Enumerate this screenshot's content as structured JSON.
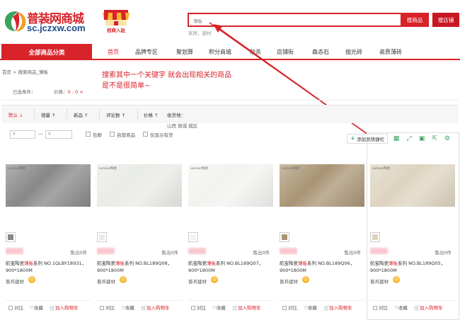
{
  "header": {
    "logo_text": "普装网商城",
    "logo_url": "sc.jczxw.com",
    "shop_badge": "招商入驻",
    "search_placeholder": "薄板",
    "search_button": "搜商品",
    "shop_search_button": "搜店铺",
    "hot_words": "家居，建材"
  },
  "nav": {
    "all_categories": "全部商品分类",
    "items": [
      "首页",
      "品牌专区",
      "聚划算",
      "积分商城",
      "秒杀",
      "店铺街",
      "森态石",
      "抛光砖",
      "瓷质薄砖"
    ]
  },
  "breadcrumb": "首页 > 搜索商品_薄板",
  "annotation": {
    "line1": "搜索其中一个关键字 就会出现相关的商品",
    "line2": "是不是很简单~"
  },
  "filter": {
    "label": "已选条件：",
    "tag_name": "价格：",
    "tag_value": "0 - 0",
    "tag_close": "×"
  },
  "sort": {
    "default": "默认",
    "sales": "销量",
    "new": "新品",
    "reviews": "评论数",
    "price": "价格",
    "location_label": "收货地：",
    "location_value": "山西 晋城 城区"
  },
  "price_filter": {
    "min_placeholder": "¥",
    "dash": "—",
    "max_placeholder": "¥",
    "free_shipping": "包邮",
    "self_operated": "自营商品",
    "in_stock": "仅显示有货"
  },
  "toolbar": {
    "add_quick": "添加到快捷栏",
    "add_icon": "+"
  },
  "products": [
    {
      "name_prefix": "航宝陶瓷",
      "name_kw": "薄板",
      "name_suffix": "系列 NO.1QLBY18931，900*1800M",
      "sold": "售出0件",
      "seller": "晋兵建材",
      "brand": "Lonsun陶瓷",
      "color": "#888888",
      "compare": "对比",
      "favorite": "收藏",
      "cart": "加入购物车"
    },
    {
      "name_prefix": "航宝陶瓷",
      "name_kw": "薄板",
      "name_suffix": "系列 NO.BL189Q08，900*1800M",
      "sold": "售出0件",
      "seller": "晋兵建材",
      "brand": "Lonsun陶瓷",
      "color": "#e9ebe6",
      "compare": "对比",
      "favorite": "收藏",
      "cart": "加入购物车"
    },
    {
      "name_prefix": "航宝陶瓷",
      "name_kw": "薄板",
      "name_suffix": "系列 NO.BL189Q07，900*1800M",
      "sold": "售出0件",
      "seller": "晋兵建材",
      "brand": "Lonsun陶瓷",
      "color": "#f2f2f0",
      "compare": "对比",
      "favorite": "收藏",
      "cart": "加入购物车"
    },
    {
      "name_prefix": "航宝陶瓷",
      "name_kw": "薄板",
      "name_suffix": "系列 NO.BL189Q06，900*1800M",
      "sold": "售出0件",
      "seller": "晋兵建材",
      "brand": "Lonsun陶瓷",
      "color": "#a99474",
      "compare": "对比",
      "favorite": "收藏",
      "cart": "加入购物车"
    },
    {
      "name_prefix": "航宝陶瓷",
      "name_kw": "薄板",
      "name_suffix": "系列 NO.BL189Q05，900*1800M",
      "sold": "售出0件",
      "seller": "晋兵建材",
      "brand": "Lonsun陶瓷",
      "color": "#ddd3bf",
      "compare": "对比",
      "favorite": "收藏",
      "cart": "加入购物车"
    }
  ]
}
